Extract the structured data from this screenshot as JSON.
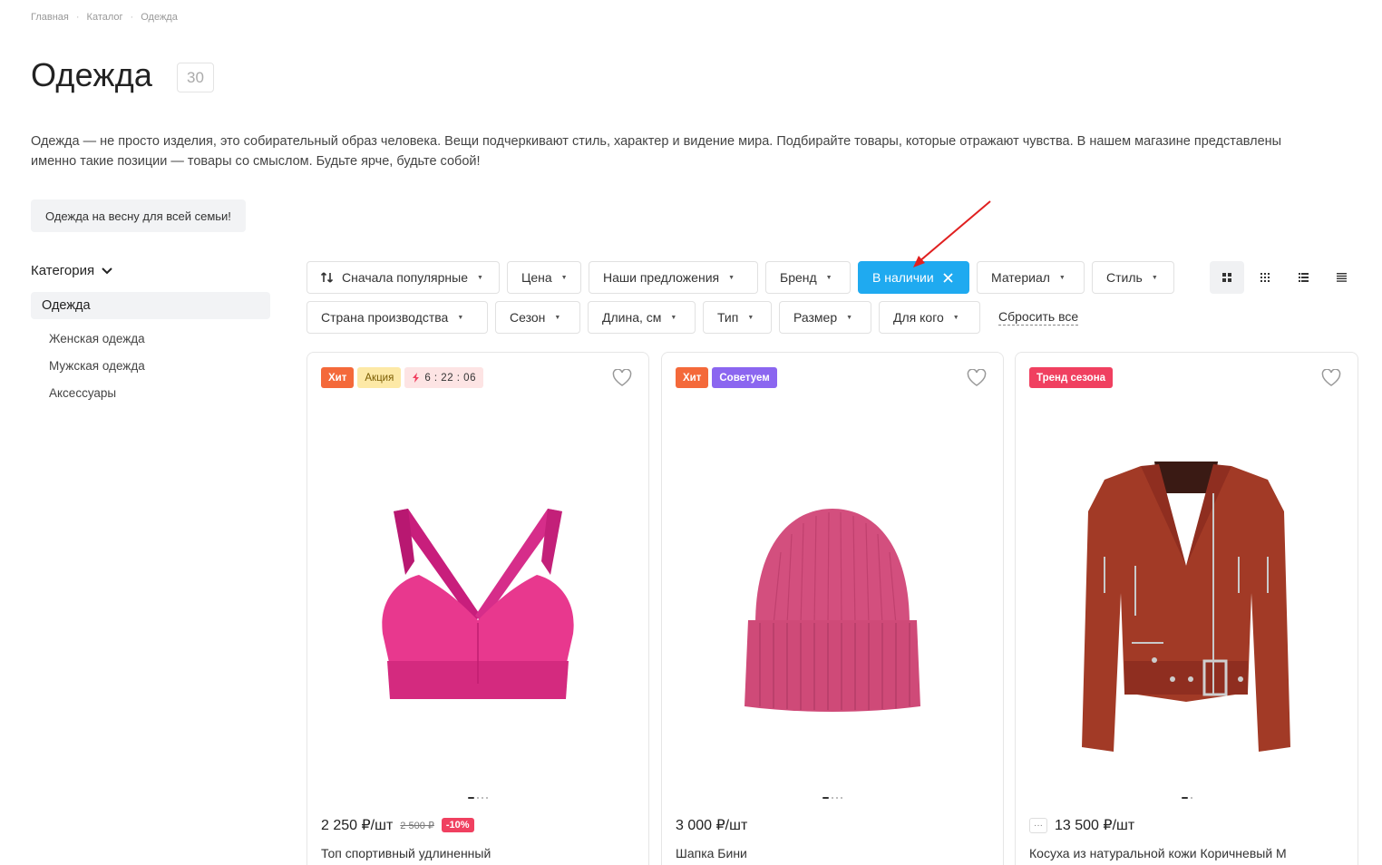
{
  "breadcrumb": [
    "Главная",
    "Каталог",
    "Одежда"
  ],
  "page": {
    "title": "Одежда",
    "count": "30",
    "description": "Одежда — не просто изделия, это собирательный образ человека. Вещи подчеркивают стиль, характер и видение мира. Подбирайте товары, которые отражают чувства. В нашем магазине представлены именно такие позиции — товары со смыслом. Будьте ярче, будьте собой!",
    "promo_tag": "Одежда на весну для всей семьи!"
  },
  "sidebar": {
    "heading": "Категория",
    "active": "Одежда",
    "items": [
      "Женская одежда",
      "Мужская одежда",
      "Аксессуары"
    ]
  },
  "filters": {
    "sort": "Сначала популярные",
    "row1": [
      "Цена",
      "Наши предложения",
      "Бренд"
    ],
    "active": "В наличии",
    "row1b": [
      "Материал",
      "Стиль"
    ],
    "row2": [
      "Страна производства",
      "Сезон",
      "Длина, см",
      "Тип",
      "Размер",
      "Для кого"
    ],
    "reset": "Сбросить все"
  },
  "products": [
    {
      "badges": [
        "Хит",
        "Акция"
      ],
      "timer": "6 : 22 : 06",
      "price": "2 250 ₽/шт",
      "old_price": "2 500 ₽",
      "discount": "-10%",
      "name": "Топ спортивный удлиненный",
      "image": "pink-sports-bra"
    },
    {
      "badges": [
        "Хит",
        "Советуем"
      ],
      "price": "3 000 ₽/шт",
      "name": "Шапка Бини",
      "image": "pink-beanie"
    },
    {
      "badges": [
        "Тренд сезона"
      ],
      "more": "···",
      "price": "13 500 ₽/шт",
      "name": "Косуха из натуральной кожи Коричневый М",
      "image": "brown-leather-jacket"
    }
  ],
  "colors": {
    "accent": "#1faaf0",
    "hit": "#f4693a",
    "trend": "#f04060",
    "advice": "#8b66f0"
  }
}
